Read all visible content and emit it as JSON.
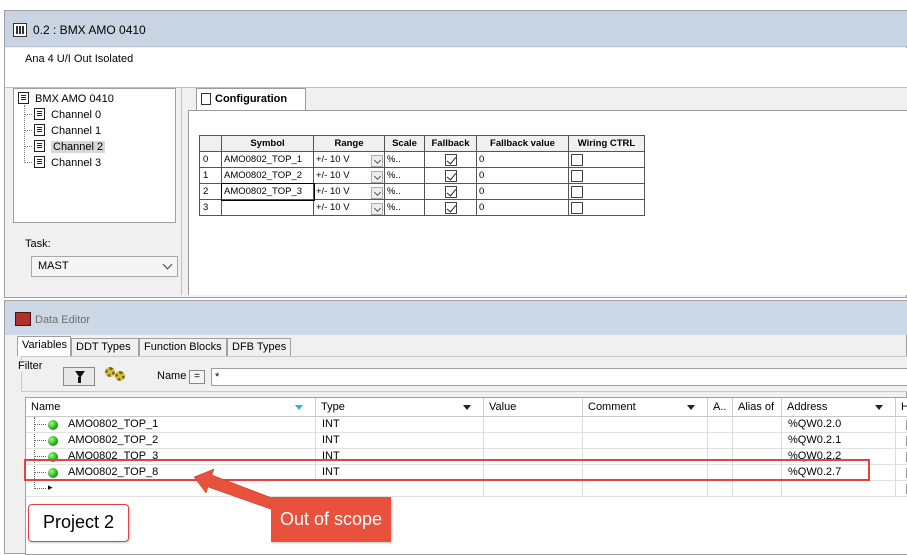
{
  "module_window": {
    "title": "0.2 : BMX AMO 0410",
    "description": "Ana 4 U/I Out Isolated",
    "tree": {
      "root": "BMX AMO 0410",
      "channels": [
        "Channel 0",
        "Channel 1",
        "Channel 2",
        "Channel 3"
      ],
      "selected": "Channel 2"
    },
    "task_label": "Task:",
    "task_value": "MAST",
    "config_tab": "Configuration",
    "table": {
      "headers": [
        "Symbol",
        "Range",
        "Scale",
        "Fallback",
        "Fallback value",
        "Wiring CTRL"
      ],
      "rows": [
        {
          "idx": "0",
          "symbol": "AMO0802_TOP_1",
          "range": "+/- 10 V",
          "scale": "%..",
          "fallback": true,
          "fallback_value": "0",
          "wiring": false
        },
        {
          "idx": "1",
          "symbol": "AMO0802_TOP_2",
          "range": "+/- 10 V",
          "scale": "%..",
          "fallback": true,
          "fallback_value": "0",
          "wiring": false
        },
        {
          "idx": "2",
          "symbol": "AMO0802_TOP_3",
          "range": "+/- 10 V",
          "scale": "%..",
          "fallback": true,
          "fallback_value": "0",
          "wiring": false
        },
        {
          "idx": "3",
          "symbol": "",
          "range": "+/- 10 V",
          "scale": "%..",
          "fallback": true,
          "fallback_value": "0",
          "wiring": false
        }
      ]
    }
  },
  "data_editor": {
    "title": "Data Editor",
    "tabs": [
      "Variables",
      "DDT Types",
      "Function Blocks",
      "DFB Types"
    ],
    "filter_label": "Filter",
    "name_label": "Name",
    "eq_label": "=",
    "name_filter": "*",
    "columns": [
      "Name",
      "Type",
      "Value",
      "Comment",
      "A..",
      "Alias of",
      "Address",
      "H"
    ],
    "rows": [
      {
        "name": "AMO0802_TOP_1",
        "type": "INT",
        "value": "",
        "comment": "",
        "address": "%QW0.2.0"
      },
      {
        "name": "AMO0802_TOP_2",
        "type": "INT",
        "value": "",
        "comment": "",
        "address": "%QW0.2.1"
      },
      {
        "name": "AMO0802_TOP_3",
        "type": "INT",
        "value": "",
        "comment": "",
        "address": "%QW0.2.2"
      },
      {
        "name": "AMO0802_TOP_8",
        "type": "INT",
        "value": "",
        "comment": "",
        "address": "%QW0.2.7"
      }
    ]
  },
  "annotations": {
    "project_label": "Project 2",
    "scope_label": "Out of scope",
    "accent_color": "#e8513c"
  }
}
